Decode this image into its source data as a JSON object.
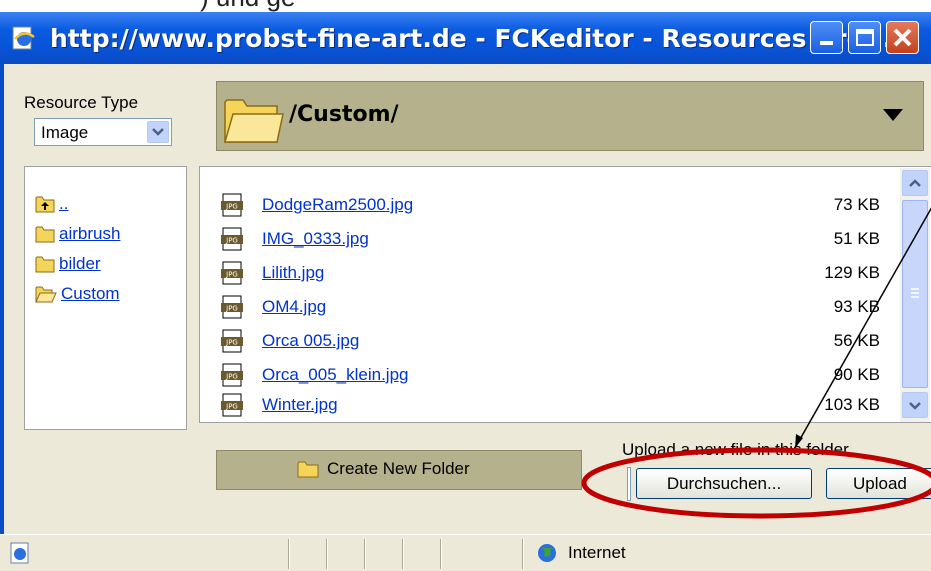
{
  "window": {
    "top_fragment": ") und ge",
    "title": "http://www.probst-fine-art.de - FCKeditor - Resources Bro...",
    "controls": [
      "minimize",
      "maximize",
      "close"
    ]
  },
  "resource_type": {
    "label": "Resource Type",
    "selected": "Image"
  },
  "current_folder": {
    "path": "/Custom/"
  },
  "folders": [
    {
      "name": "..",
      "icon": "folder-up-icon"
    },
    {
      "name": "airbrush",
      "icon": "folder-icon"
    },
    {
      "name": "bilder",
      "icon": "folder-icon"
    },
    {
      "name": "Custom",
      "icon": "folder-open-icon"
    }
  ],
  "files": [
    {
      "name": "DodgeRam2500.jpg",
      "size": "73 KB"
    },
    {
      "name": "IMG_0333.jpg",
      "size": "51 KB"
    },
    {
      "name": "Lilith.jpg",
      "size": "129 KB"
    },
    {
      "name": "OM4.jpg",
      "size": "93 KB"
    },
    {
      "name": "Orca 005.jpg",
      "size": "56 KB"
    },
    {
      "name": "Orca_005_klein.jpg",
      "size": "90 KB"
    },
    {
      "name": "Winter.jpg",
      "size": "103 KB"
    }
  ],
  "actions": {
    "create_folder": "Create New Folder",
    "upload_label": "Upload a new file in this folder",
    "browse": "Durchsuchen...",
    "upload": "Upload"
  },
  "status": {
    "zone": "Internet"
  },
  "colors": {
    "titlebar": "#0a5ae0",
    "panel": "#b5b18c",
    "link": "#0033cc",
    "annotation_ellipse": "#c00000"
  }
}
